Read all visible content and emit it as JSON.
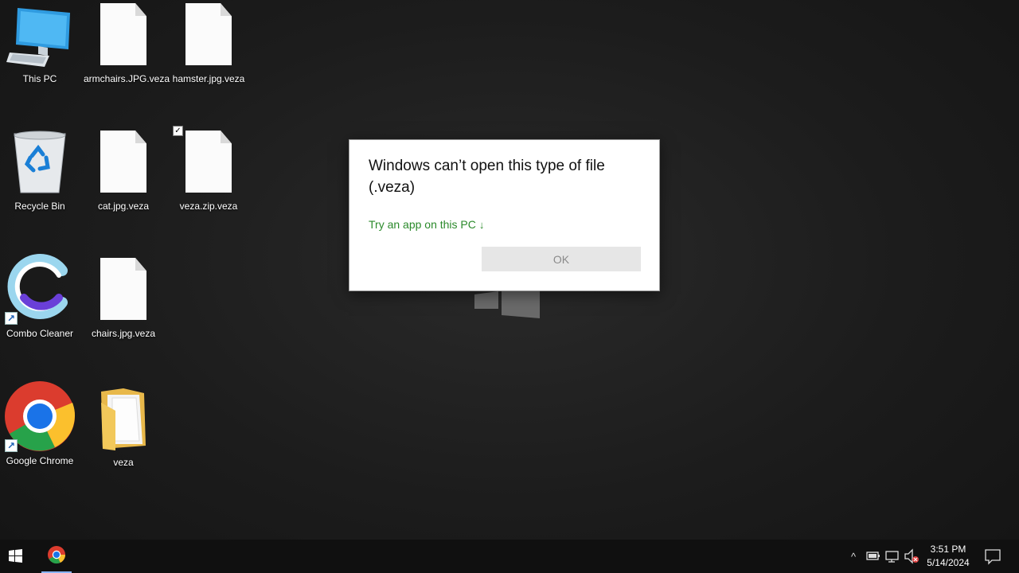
{
  "desktop": {
    "icons": [
      {
        "label": "This PC",
        "icon": "this-pc-icon"
      },
      {
        "label": "armchairs.JPG.veza",
        "icon": "file-icon"
      },
      {
        "label": "hamster.jpg.veza",
        "icon": "file-icon"
      },
      {
        "label": "Recycle Bin",
        "icon": "recycle-bin-icon"
      },
      {
        "label": "cat.jpg.veza",
        "icon": "file-icon"
      },
      {
        "label": "veza.zip.veza",
        "icon": "file-icon"
      },
      {
        "label": "Combo Cleaner",
        "icon": "combo-cleaner-icon"
      },
      {
        "label": "chairs.jpg.veza",
        "icon": "file-icon"
      },
      {
        "label": "Google Chrome",
        "icon": "chrome-icon"
      },
      {
        "label": "veza",
        "icon": "folder-icon"
      }
    ]
  },
  "dialog": {
    "title": "Windows can’t open this type of file (.veza)",
    "link": "Try an app on this PC",
    "link_arrow": "↓",
    "ok_label": "OK"
  },
  "taskbar": {
    "start_icon": "windows-start-icon",
    "pinned": [
      {
        "name": "Google Chrome",
        "icon": "chrome-icon"
      }
    ],
    "tray": {
      "chevron": "^",
      "time": "3:51 PM",
      "date": "5/14/2024"
    }
  },
  "colors": {
    "link_green": "#2b8a2b",
    "desktop_bg": "#1c1c1c",
    "taskbar_bg": "#101010"
  }
}
